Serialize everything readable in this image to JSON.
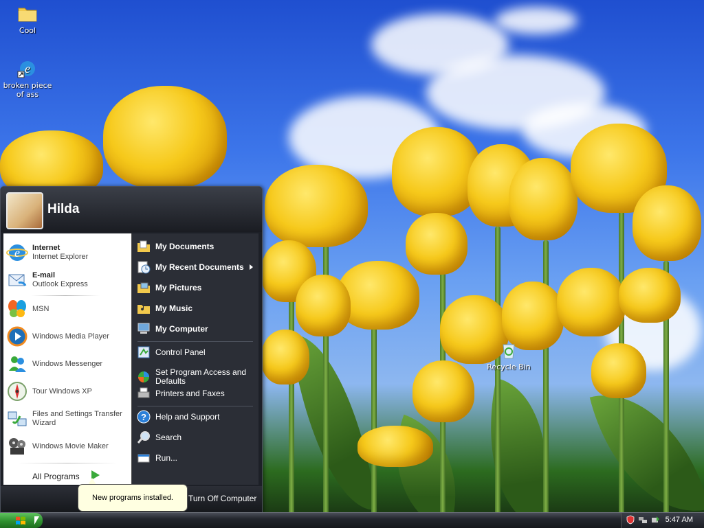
{
  "desktop": {
    "icons": [
      {
        "label": "Cool"
      },
      {
        "label": "broken piece of ass"
      },
      {
        "label": "Recycle Bin"
      }
    ]
  },
  "start_menu": {
    "username": "Hilda",
    "pinned": [
      {
        "title": "Internet",
        "subtitle": "Internet Explorer",
        "icon": "internet-explorer-icon"
      },
      {
        "title": "E-mail",
        "subtitle": "Outlook Express",
        "icon": "outlook-express-icon"
      }
    ],
    "recent": [
      {
        "label": "MSN",
        "icon": "msn-butterfly-icon"
      },
      {
        "label": "Windows Media Player",
        "icon": "media-player-icon"
      },
      {
        "label": "Windows Messenger",
        "icon": "messenger-icon"
      },
      {
        "label": "Tour Windows XP",
        "icon": "tour-xp-icon"
      },
      {
        "label": "Files and Settings Transfer Wizard",
        "icon": "transfer-wizard-icon"
      },
      {
        "label": "Windows Movie Maker",
        "icon": "movie-maker-icon"
      }
    ],
    "all_programs": "All Programs",
    "places": [
      {
        "label": "My Documents",
        "icon": "folder-documents-icon"
      },
      {
        "label": "My Recent Documents",
        "icon": "recent-documents-icon"
      },
      {
        "label": "My Pictures",
        "icon": "folder-pictures-icon"
      },
      {
        "label": "My Music",
        "icon": "folder-music-icon"
      },
      {
        "label": "My Computer",
        "icon": "computer-icon"
      }
    ],
    "system": [
      {
        "label": "Control Panel",
        "icon": "control-panel-icon"
      },
      {
        "label": "Set Program Access and Defaults",
        "icon": "program-defaults-icon"
      },
      {
        "label": "Printers and Faxes",
        "icon": "printer-icon"
      }
    ],
    "help": [
      {
        "label": "Help and Support",
        "icon": "help-icon"
      },
      {
        "label": "Search",
        "icon": "search-icon"
      },
      {
        "label": "Run...",
        "icon": "run-icon"
      }
    ],
    "turn_off": "Turn Off Computer",
    "balloon": "New programs installed."
  },
  "taskbar": {
    "clock": "5:47 AM"
  }
}
